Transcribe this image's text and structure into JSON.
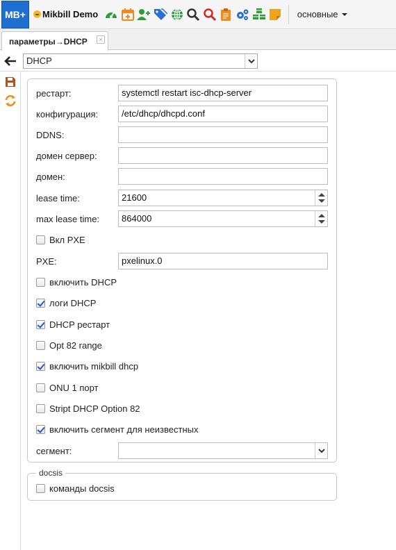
{
  "app": {
    "logo_text": "MB+",
    "brand_name": "Mikbill Demo",
    "menu_label": "основные"
  },
  "toolbar_icons": [
    {
      "name": "dashboard-icon",
      "color": "#2e9c3a"
    },
    {
      "name": "calendar-plus-icon",
      "color": "#f08a1c"
    },
    {
      "name": "add-user-icon",
      "color": "#2e9c3a"
    },
    {
      "name": "tags-icon",
      "color": "#2a6fd0"
    },
    {
      "name": "globe-icon",
      "color": "#2e9c3a"
    },
    {
      "name": "search-icon",
      "color": "#333333"
    },
    {
      "name": "search-red-icon",
      "color": "#d7261e"
    },
    {
      "name": "clipboard-icon",
      "color": "#f08a1c"
    },
    {
      "name": "cogs-icon",
      "color": "#2a6fd0"
    },
    {
      "name": "cubes-icon",
      "color": "#2e9c3a"
    },
    {
      "name": "note-icon",
      "color": "#f0a21c"
    }
  ],
  "tab": {
    "label": "параметры→DHCP",
    "close_glyph": "×"
  },
  "top_select": {
    "value": "DHCP"
  },
  "form": {
    "fields": {
      "restart": {
        "label": "рестарт:",
        "value": "systemctl restart isc-dhcp-server"
      },
      "config": {
        "label": "конфигурация:",
        "value": "/etc/dhcp/dhcpd.conf"
      },
      "ddns": {
        "label": "DDNS:",
        "value": ""
      },
      "domain_server": {
        "label": "домен сервер:",
        "value": ""
      },
      "domain": {
        "label": "домен:",
        "value": ""
      },
      "lease_time": {
        "label": "lease time:",
        "value": "21600"
      },
      "max_lease_time": {
        "label": "max lease time:",
        "value": "864000"
      },
      "pxe": {
        "label": "PXE:",
        "value": "pxelinux.0"
      },
      "segment": {
        "label": "сегмент:",
        "value": ""
      }
    },
    "checkboxes": {
      "pxe_on": {
        "label": "Вкл PXE",
        "checked": false
      },
      "enable_dhcp": {
        "label": "включить DHCP",
        "checked": false
      },
      "dhcp_logs": {
        "label": "логи DHCP",
        "checked": true
      },
      "dhcp_restart": {
        "label": "DHCP рестарт",
        "checked": true
      },
      "opt82_range": {
        "label": "Opt 82 range",
        "checked": false
      },
      "enable_mikbill_dhcp": {
        "label": "включить mikbill dhcp",
        "checked": true
      },
      "onu_one_port": {
        "label": "ONU 1 порт",
        "checked": false
      },
      "stript_opt82": {
        "label": "Stript DHCP Option 82",
        "checked": false
      },
      "segment_unknown": {
        "label": "включить сегмент для неизвестных",
        "checked": true
      }
    }
  },
  "docsis": {
    "legend": "docsis",
    "commands": {
      "label": "команды docsis",
      "checked": false
    }
  }
}
